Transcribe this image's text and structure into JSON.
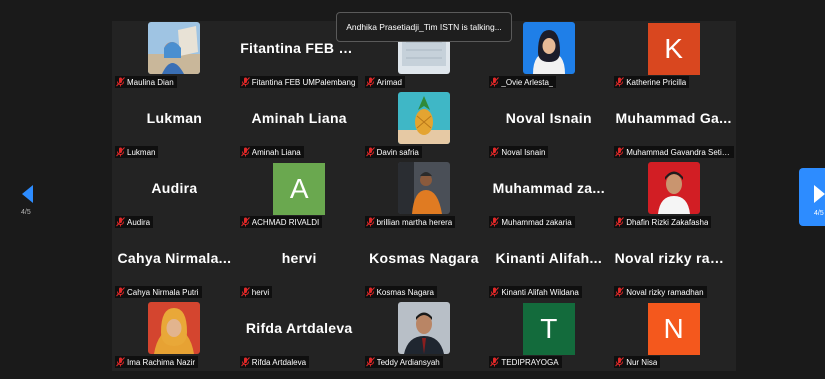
{
  "toast": {
    "text": "Andhika Prasetiadji_Tim ISTN is talking..."
  },
  "pagination": {
    "left_page": "4/5",
    "right_page": "4/5"
  },
  "colors": {
    "accent": "#2d8cff",
    "mic_muted": "#e02828"
  },
  "participants": [
    {
      "display": "",
      "label": "Maulina Dian",
      "kind": "photo",
      "photo": "sky"
    },
    {
      "display": "Fitantina FEB U...",
      "label": "Fitantina FEB UMPalembang",
      "kind": "name"
    },
    {
      "display": "",
      "label": "Arimad",
      "kind": "photo",
      "photo": "pale"
    },
    {
      "display": "",
      "label": "_Ovie Arlesta_",
      "kind": "photo",
      "photo": "hijab-blue"
    },
    {
      "display": "K",
      "label": "Katherine Pricilla",
      "kind": "letter",
      "color": "#d9471f"
    },
    {
      "display": "Lukman",
      "label": "Lukman",
      "kind": "name"
    },
    {
      "display": "Aminah Liana",
      "label": "Aminah Liana",
      "kind": "name"
    },
    {
      "display": "",
      "label": "Davin safria",
      "kind": "photo",
      "photo": "pineapple"
    },
    {
      "display": "Noval Isnain",
      "label": "Noval Isnain",
      "kind": "name"
    },
    {
      "display": "Muhammad Ga...",
      "label": "Muhammad Gavandra Setia...",
      "kind": "name"
    },
    {
      "display": "Audira",
      "label": "Audira",
      "kind": "name"
    },
    {
      "display": "A",
      "label": "ACHMAD RIVALDI",
      "kind": "letter",
      "color": "#6aa84f"
    },
    {
      "display": "",
      "label": "brillian martha herera",
      "kind": "photo",
      "photo": "orange"
    },
    {
      "display": "Muhammad za...",
      "label": "Muhammad zakaria",
      "kind": "name"
    },
    {
      "display": "",
      "label": "Dhafin Rizki Zakafasha",
      "kind": "photo",
      "photo": "red"
    },
    {
      "display": "Cahya Nirmala...",
      "label": "Cahya Nirmala Putri",
      "kind": "name"
    },
    {
      "display": "hervi",
      "label": "hervi",
      "kind": "name"
    },
    {
      "display": "Kosmas Nagara",
      "label": "Kosmas Nagara",
      "kind": "name"
    },
    {
      "display": "Kinanti Alifah...",
      "label": "Kinanti Alifah Wildana",
      "kind": "name"
    },
    {
      "display": "Noval rizky ram...",
      "label": "Noval rizky ramadhan",
      "kind": "name"
    },
    {
      "display": "",
      "label": "Ima Rachima Nazir",
      "kind": "photo",
      "photo": "hijab-orange"
    },
    {
      "display": "Rifda Artdaleva",
      "label": "Rifda Artdaleva",
      "kind": "name"
    },
    {
      "display": "",
      "label": "Teddy Ardiansyah",
      "kind": "photo",
      "photo": "suit"
    },
    {
      "display": "T",
      "label": "TEDIPRAYOGA",
      "kind": "letter",
      "color": "#136b3c"
    },
    {
      "display": "N",
      "label": "Nur Nisa",
      "kind": "letter",
      "color": "#f4581d"
    }
  ]
}
